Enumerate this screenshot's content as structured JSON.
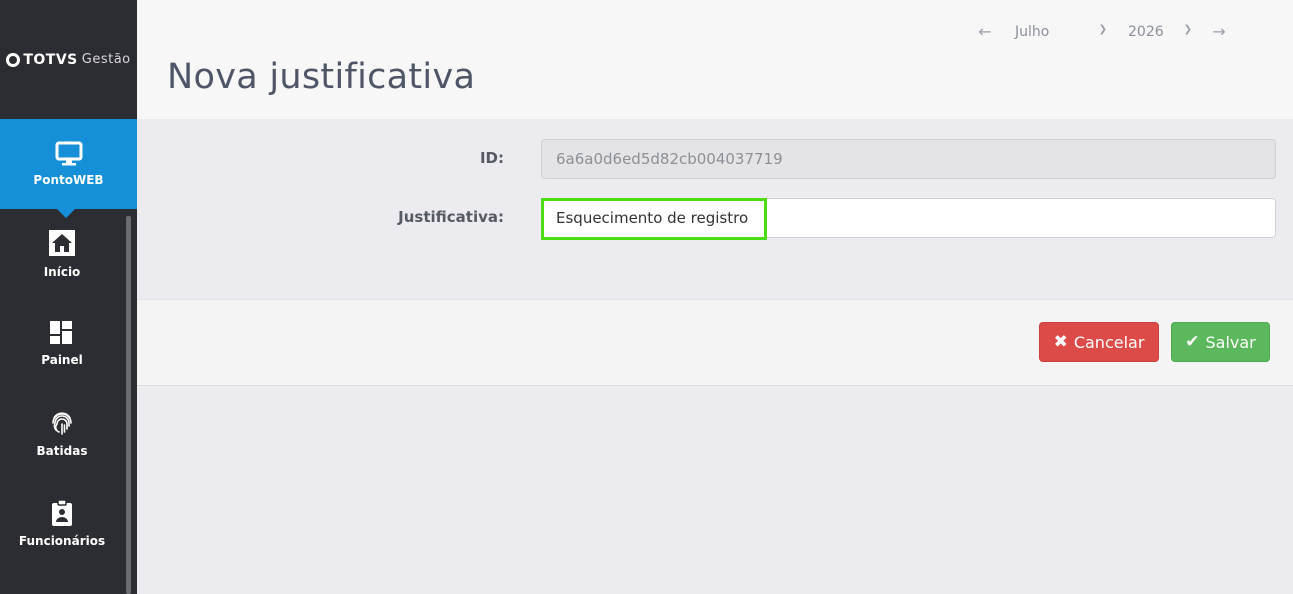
{
  "brand": {
    "name": "TOTVS",
    "product": "Gestão"
  },
  "sidebar": {
    "active": {
      "label": "PontoWEB",
      "icon": "monitor-icon"
    },
    "items": [
      {
        "label": "Início",
        "icon": "home-icon"
      },
      {
        "label": "Painel",
        "icon": "dashboard-icon"
      },
      {
        "label": "Batidas",
        "icon": "fingerprint-icon"
      },
      {
        "label": "Funcionários",
        "icon": "badge-icon"
      }
    ]
  },
  "header": {
    "title": "Nova justificativa",
    "period": {
      "month": "Julho",
      "year": "2026"
    }
  },
  "form": {
    "id_label": "ID:",
    "id_value": "6a6a0d6ed5d82cb004037719",
    "justificativa_label": "Justificativa:",
    "justificativa_value": "Esquecimento de registro"
  },
  "actions": {
    "cancel_label": "Cancelar",
    "save_label": "Salvar"
  },
  "colors": {
    "sidebar_bg": "#2c2d32",
    "active_bg": "#1590d8",
    "cancel": "#dd4b48",
    "save": "#5cb85c",
    "highlight": "#4cdc14"
  }
}
